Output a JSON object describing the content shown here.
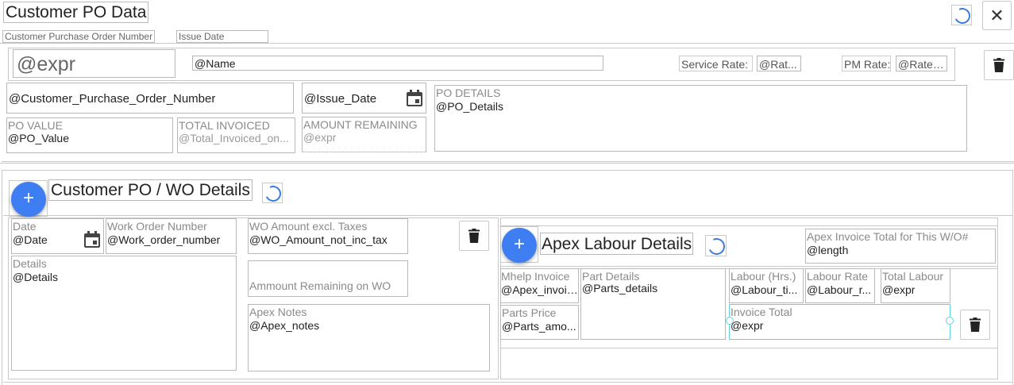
{
  "header": {
    "title": "Customer PO Data",
    "close_icon": "close-icon",
    "subheaders": [
      "Customer Purchase Order Number",
      "Issue Date"
    ]
  },
  "po": {
    "expr_value": "@expr",
    "name_value": "@Name",
    "service_rate_label": "Service Rate:",
    "service_rate_value": "@Rat...",
    "pm_rate_label": "PM Rate:",
    "pm_rate_value": "@Rate_...",
    "customer_po_number": "@Customer_Purchase_Order_Number",
    "issue_date": "@Issue_Date",
    "po_details_label": "PO DETAILS",
    "po_details_value": "@PO_Details",
    "po_value_label": "PO VALUE",
    "po_value": "@PO_Value",
    "total_invoiced_label": "TOTAL INVOICED",
    "total_invoiced_value": "@Total_Invoiced_on...",
    "amount_remaining_label": "AMOUNT REMAINING",
    "amount_remaining_value": "@expr"
  },
  "wo_section": {
    "title": "Customer PO / WO Details",
    "add_label": "+",
    "date_label": "Date",
    "date_value": "@Date",
    "work_order_number_label": "Work Order Number",
    "work_order_number_value": "@Work_order_number",
    "details_label": "Details",
    "details_value": "@Details",
    "wo_amount_label": "WO Amount excl. Taxes",
    "wo_amount_value": "@WO_Amount_not_inc_tax",
    "amount_remaining_wo_label": "Ammount Remaining on WO",
    "apex_notes_label": "Apex Notes",
    "apex_notes_value": "@Apex_notes"
  },
  "labour": {
    "title": "Apex Labour Details",
    "add_label": "+",
    "invoice_total_wo_label": "Apex  Invoice Total for This W/O#",
    "invoice_total_wo_value": "@length",
    "mhelp_invoice_label": "Mhelp Invoice",
    "mhelp_invoice_value": "@Apex_invoice",
    "part_details_label": "Part Details",
    "part_details_value": "@Parts_details",
    "labour_hrs_label": "Labour (Hrs.)",
    "labour_hrs_value": "@Labour_ti...",
    "labour_rate_label": "Labour Rate",
    "labour_rate_value": "@Labour_r...",
    "total_labour_label": "Total Labour",
    "total_labour_value": "@expr",
    "parts_price_label": "Parts Price",
    "parts_price_value": "@Parts_amo...",
    "invoice_total_label": "Invoice Total",
    "invoice_total_value": "@expr"
  },
  "colors": {
    "accent": "#3f7df3",
    "spinner": "#3a7be0",
    "selection": "#5fd3e0",
    "border": "#b9b9b9"
  }
}
